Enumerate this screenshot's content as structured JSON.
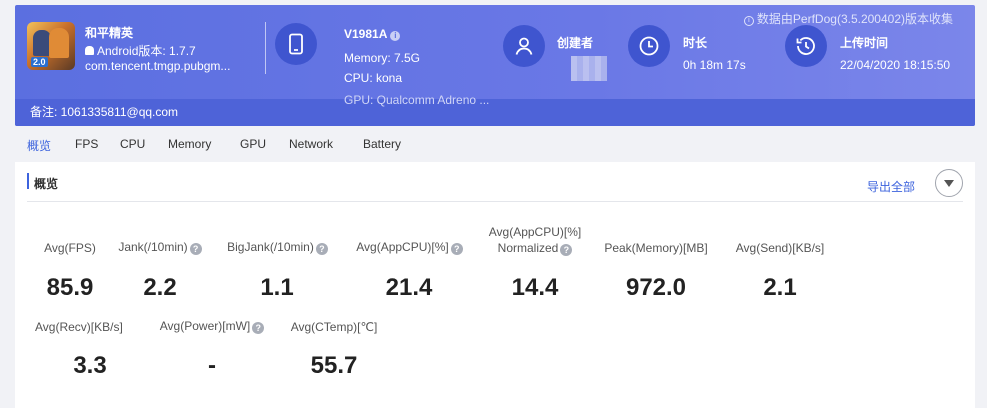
{
  "header": {
    "top_note": "数据由PerfDog(3.5.200402)版本收集",
    "app": {
      "name": "和平精英",
      "icon_badge": "2.0",
      "os": "Android版本: 1.7.7",
      "package": "com.tencent.tmgp.pubgm..."
    },
    "device": {
      "name": "V1981A",
      "memory": "Memory: 7.5G",
      "cpu": "CPU: kona",
      "gpu": "GPU: Qualcomm Adreno ..."
    },
    "creator": {
      "label": "创建者"
    },
    "duration": {
      "label": "时长",
      "value": "0h 18m 17s"
    },
    "upload": {
      "label": "上传时间",
      "value": "22/04/2020 18:15:50"
    },
    "remark": "备注: 1061335811@qq.com",
    "icons": {
      "device": "phone-icon",
      "creator": "user-icon",
      "duration": "clock-icon",
      "upload": "history-icon"
    }
  },
  "tabs": [
    "概览",
    "FPS",
    "CPU",
    "Memory",
    "GPU",
    "Network",
    "Battery"
  ],
  "panel": {
    "title": "概览",
    "export": "导出全部",
    "metrics": [
      {
        "label": "Avg(FPS)",
        "value": "85.9",
        "help": false
      },
      {
        "label": "Jank(/10min)",
        "value": "2.2",
        "help": true
      },
      {
        "label": "BigJank(/10min)",
        "value": "1.1",
        "help": true
      },
      {
        "label": "Avg(AppCPU)[%]",
        "value": "21.4",
        "help": true
      },
      {
        "label": "Avg(AppCPU)[%]",
        "label2": "Normalized",
        "value": "14.4",
        "help": true
      },
      {
        "label": "Peak(Memory)[MB]",
        "value": "972.0",
        "help": false
      },
      {
        "label": "Avg(Send)[KB/s]",
        "value": "2.1",
        "help": false
      },
      {
        "label": "Avg(Recv)[KB/s]",
        "value": "3.3",
        "help": false
      },
      {
        "label": "Avg(Power)[mW]",
        "value": "-",
        "help": true
      },
      {
        "label": "Avg(CTemp)[℃]",
        "value": "55.7",
        "help": false
      }
    ]
  },
  "colors": {
    "accent": "#3d63dd",
    "header_start": "#5b6fe0",
    "header_end": "#7b86ea",
    "icon_circle": "#3f55cf"
  }
}
